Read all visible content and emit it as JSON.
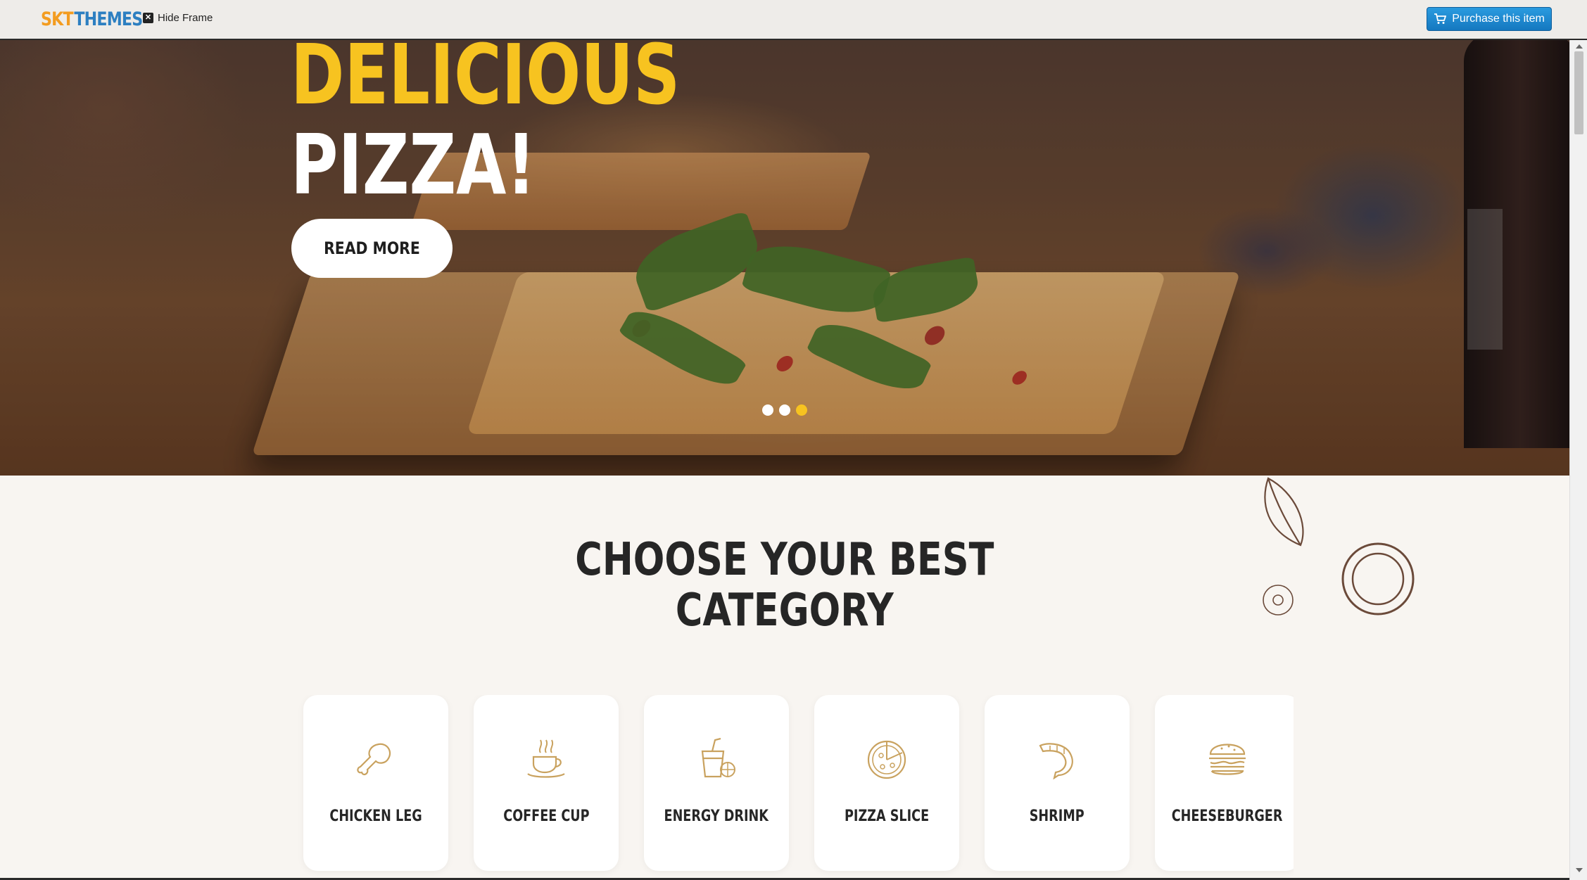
{
  "frame": {
    "logo_part1": "SKT",
    "logo_part2": "THEMES",
    "hide_frame_label": "Hide Frame",
    "purchase_label": "Purchase this item"
  },
  "hero": {
    "title_line1": "DELICIOUS",
    "title_line2": "PIZZA!",
    "button_label": "READ MORE",
    "slides_total": 3,
    "active_slide": 3
  },
  "categories": {
    "title": "CHOOSE YOUR BEST CATEGORY",
    "items": [
      {
        "label": "CHICKEN LEG",
        "icon": "chicken-leg-icon"
      },
      {
        "label": "COFFEE CUP",
        "icon": "coffee-cup-icon"
      },
      {
        "label": "ENERGY DRINK",
        "icon": "energy-drink-icon"
      },
      {
        "label": "PIZZA SLICE",
        "icon": "pizza-slice-icon"
      },
      {
        "label": "SHRIMP",
        "icon": "shrimp-icon"
      },
      {
        "label": "CHEESEBURGER",
        "icon": "cheeseburger-icon"
      }
    ]
  },
  "colors": {
    "accent_yellow": "#f7c320",
    "icon_gold": "#c9a25f",
    "purchase_blue": "#1a88d0",
    "section_bg": "#f8f5f1"
  }
}
